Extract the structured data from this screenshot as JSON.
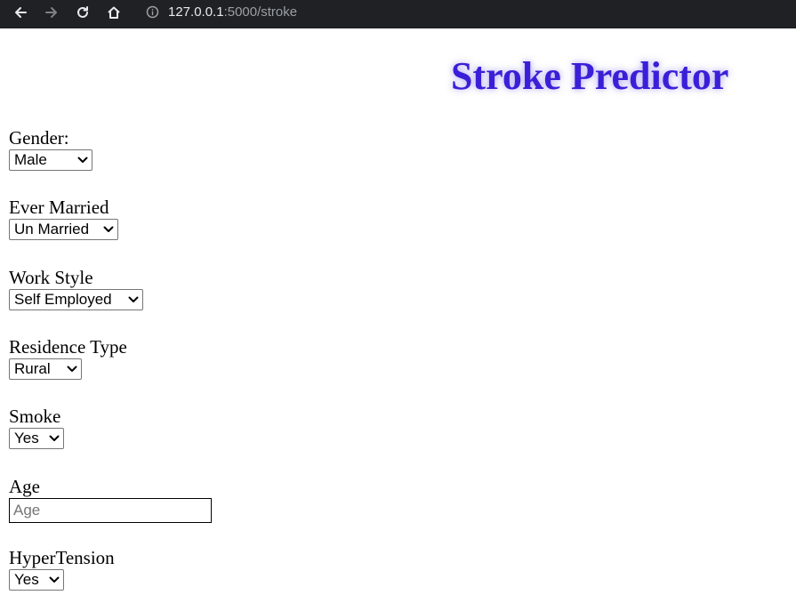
{
  "browser": {
    "host": "127.0.0.1",
    "path": ":5000/stroke"
  },
  "page": {
    "title": "Stroke Predictor",
    "title_color": "#3a1fd8"
  },
  "form": {
    "gender": {
      "label": "Gender:",
      "value": "Male"
    },
    "ever_married": {
      "label": "Ever Married",
      "value": "Un Married"
    },
    "work_style": {
      "label": "Work Style",
      "value": "Self Employed"
    },
    "residence_type": {
      "label": "Residence Type",
      "value": "Rural"
    },
    "smoke": {
      "label": "Smoke",
      "value": "Yes"
    },
    "age": {
      "label": "Age",
      "placeholder": "Age",
      "value": ""
    },
    "hypertension": {
      "label": "HyperTension",
      "value": "Yes"
    }
  }
}
